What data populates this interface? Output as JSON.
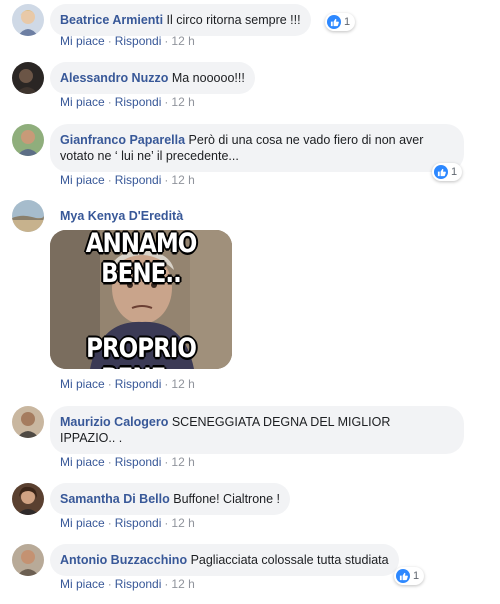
{
  "labels": {
    "like": "Mi piace",
    "reply": "Rispondi",
    "sep": "·"
  },
  "comments": [
    {
      "author": "Beatrice Armienti",
      "text": "Il circo ritorna sempre !!!",
      "time": "12 h",
      "reactions": "1"
    },
    {
      "author": "Alessandro Nuzzo",
      "text": "Ma nooooo!!!",
      "time": "12 h"
    },
    {
      "author": "Gianfranco Paparella",
      "text_line1": "Però di una cosa ne vado fiero di non aver",
      "text_line2": "votato ne ‘ lui ne’ il precedente...",
      "time": "12 h",
      "reactions": "1"
    },
    {
      "author": "Mya Kenya D'Eredità",
      "meme_top": "ANNAMO BENE..",
      "meme_bottom": "PROPRIO BENE..",
      "time": "12 h"
    },
    {
      "author": "Maurizio Calogero",
      "text_line1": "SCENEGGIATA DEGNA DEL MIGLIOR",
      "text_line2": "IPPAZIO.. .",
      "time": "12 h"
    },
    {
      "author": "Samantha Di Bello",
      "text": "Buffone! Cialtrone !",
      "time": "12 h"
    },
    {
      "author": "Antonio Buzzacchino",
      "text": "Pagliacciata colossale tutta studiata",
      "time": "12 h",
      "reactions": "1"
    }
  ],
  "colors": {
    "link": "#385898",
    "bubble": "#f2f3f5",
    "like": "#2d88ff",
    "meta": "#90949c"
  },
  "icons": {
    "reaction": "thumbs-up-icon"
  }
}
